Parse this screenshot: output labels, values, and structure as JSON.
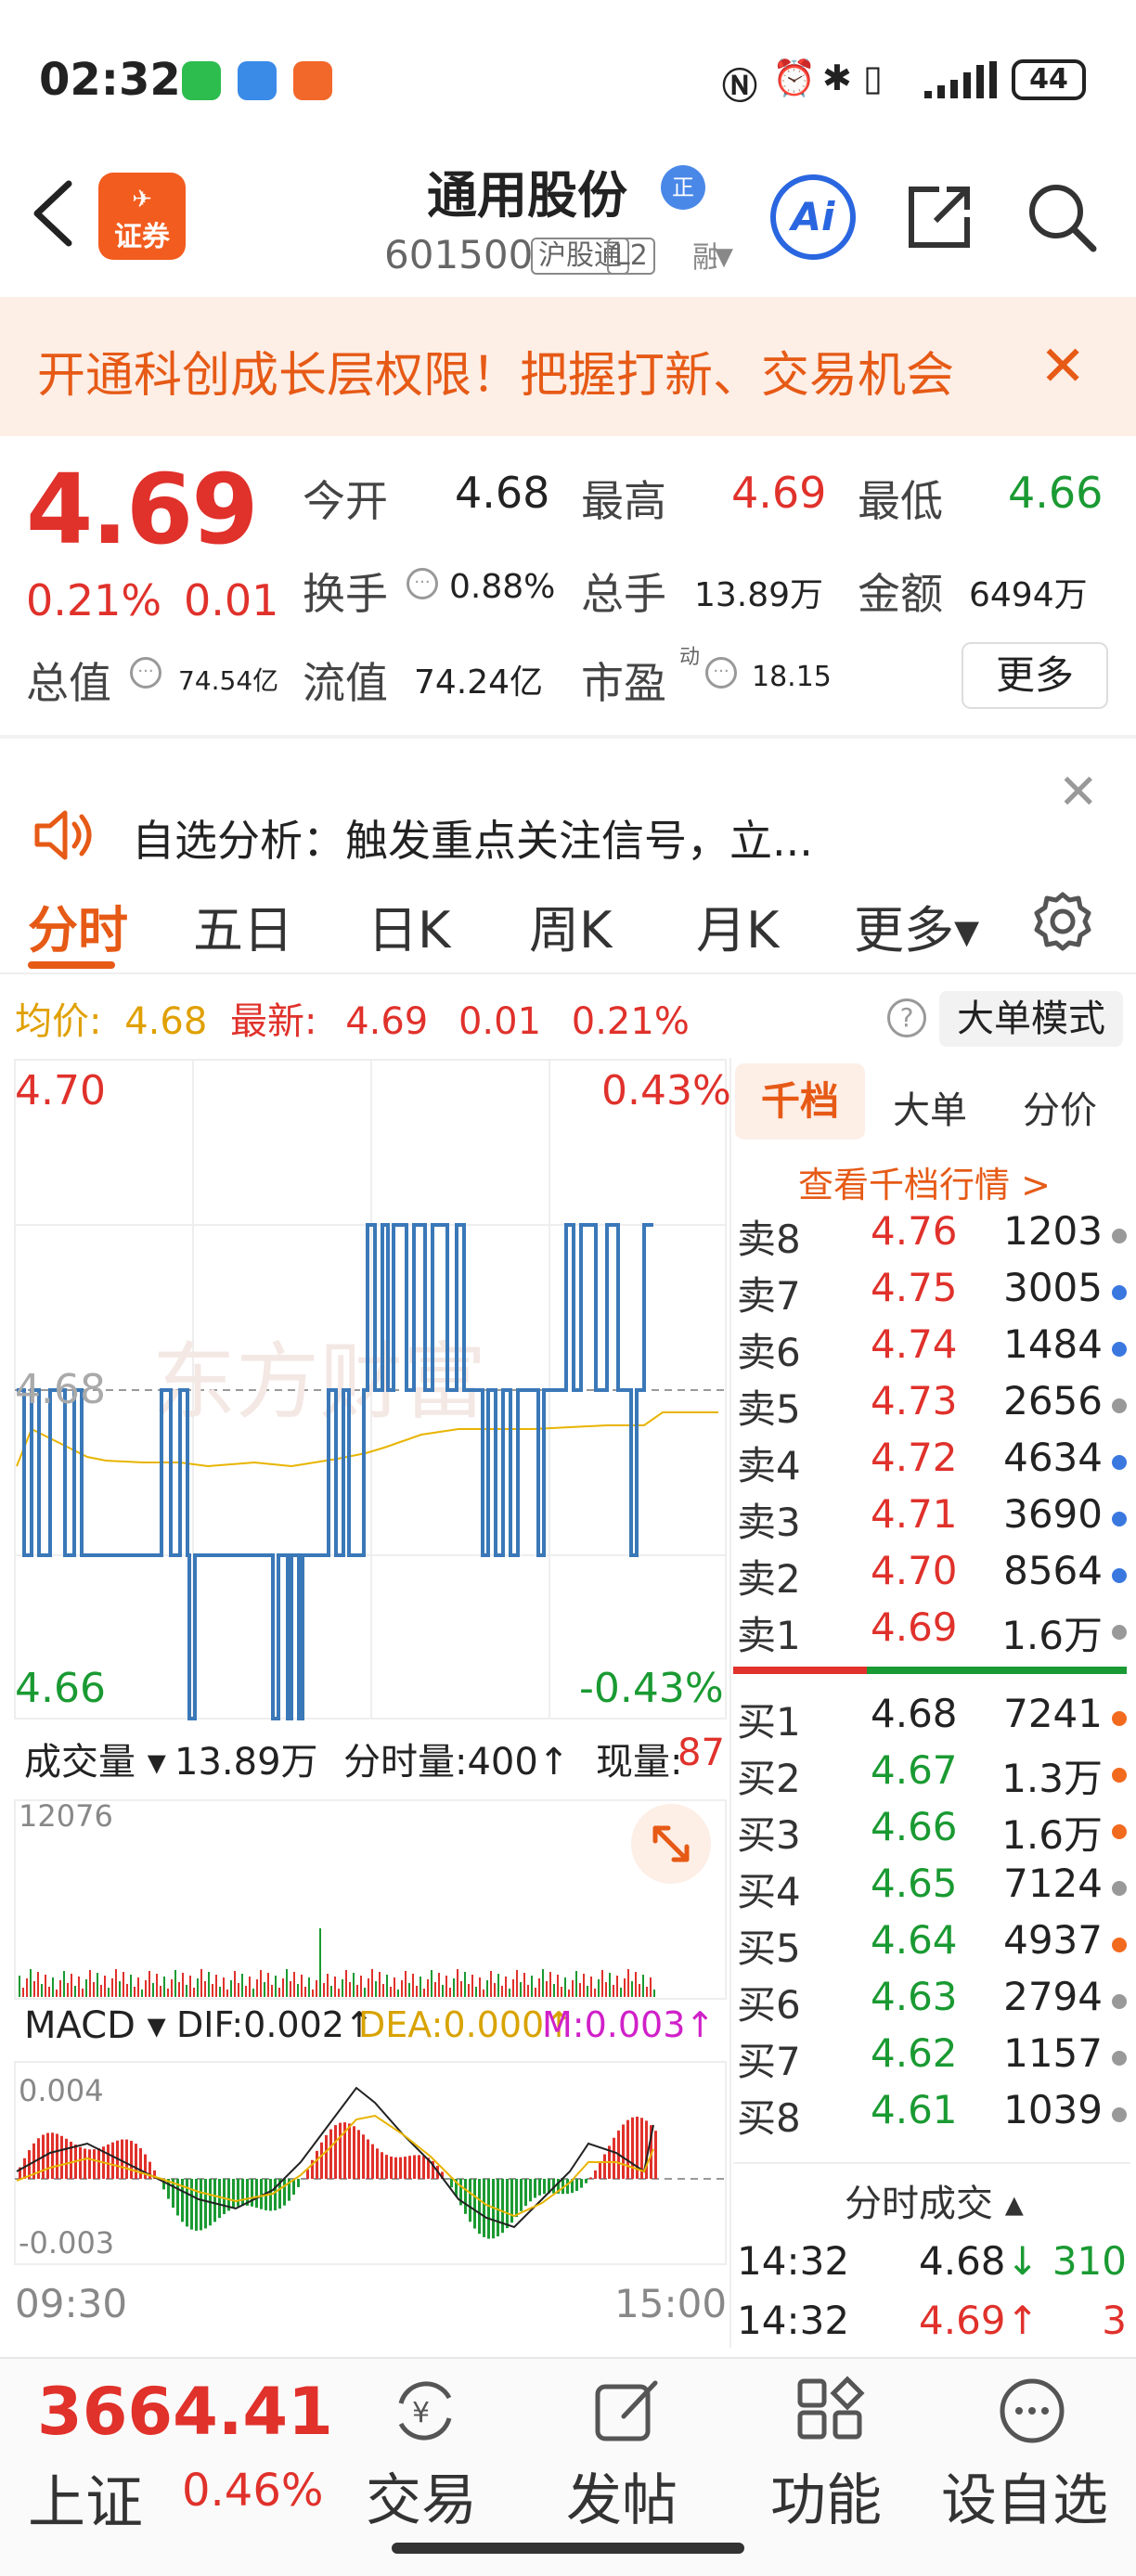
{
  "status_bar": {
    "time": "02:32",
    "battery": "44"
  },
  "header": {
    "back_icon": "chevron-left-icon",
    "logo_text": "证券",
    "stock_name": "通用股份",
    "badge": "正",
    "stock_code": "601500",
    "tag1": "沪股通",
    "tag2": "L2",
    "tag3": "融"
  },
  "banner": {
    "text": "开通科创成长层权限！把握打新、交易机会",
    "close": "✕"
  },
  "quote": {
    "price": "4.69",
    "change_pct": "0.21%",
    "change_val": "0.01",
    "open_label": "今开",
    "open": "4.68",
    "high_label": "最高",
    "high": "4.69",
    "low_label": "最低",
    "low": "4.66",
    "turnover_label": "换手",
    "turnover": "0.88%",
    "volume_label": "总手",
    "volume": "13.89万",
    "amount_label": "金额",
    "amount": "6494万",
    "mktcap_label": "总值",
    "mktcap": "74.54亿",
    "float_label": "流值",
    "float": "74.24亿",
    "pe_label": "市盈",
    "pe_sup": "动",
    "pe": "18.15",
    "more": "更多"
  },
  "notice": {
    "text": "自选分析：触发重点关注信号，立...",
    "close": "✕"
  },
  "tabs": [
    "分时",
    "五日",
    "日K",
    "周K",
    "月K",
    "更多▾"
  ],
  "price_row": {
    "avg_label": "均价:",
    "avg": "4.68",
    "latest_label": "最新:",
    "latest": "4.69",
    "chg": "0.01",
    "pct": "0.21%",
    "help": "?",
    "big_order": "大单模式"
  },
  "chart": {
    "y_top": "4.70",
    "pct_top": "0.43%",
    "y_mid": "4.68",
    "y_bot": "4.66",
    "pct_bot": "-0.43%",
    "vol_label": "成交量 ▾",
    "vol_total": "13.89万",
    "vol_unit": "分时量:400↑",
    "vol_now_label": "现量:",
    "vol_now": "87",
    "vol_max": "12076",
    "macd_label": "MACD ▾",
    "dif": "DIF:0.002↑",
    "dea": "DEA:0.000↑",
    "m": "M:0.003↑",
    "macd_top": "0.004",
    "macd_bot": "-0.003",
    "time_start": "09:30",
    "time_end": "15:00"
  },
  "order_book": {
    "tabs": [
      "千档",
      "大单",
      "分价"
    ],
    "link": "查看千档行情 >",
    "asks": [
      {
        "label": "卖8",
        "price": "4.76",
        "vol": "1203",
        "dot": "#999999"
      },
      {
        "label": "卖7",
        "price": "4.75",
        "vol": "3005",
        "dot": "#3a78e0"
      },
      {
        "label": "卖6",
        "price": "4.74",
        "vol": "1484",
        "dot": "#3a78e0"
      },
      {
        "label": "卖5",
        "price": "4.73",
        "vol": "2656",
        "dot": "#999999"
      },
      {
        "label": "卖4",
        "price": "4.72",
        "vol": "4634",
        "dot": "#3a78e0"
      },
      {
        "label": "卖3",
        "price": "4.71",
        "vol": "3690",
        "dot": "#3a78e0"
      },
      {
        "label": "卖2",
        "price": "4.70",
        "vol": "8564",
        "dot": "#3a78e0"
      },
      {
        "label": "卖1",
        "price": "4.69",
        "vol": "1.6万",
        "dot": "#999999"
      }
    ],
    "bids": [
      {
        "label": "买1",
        "price": "4.68",
        "vol": "7241",
        "dot": "#f26a1e"
      },
      {
        "label": "买2",
        "price": "4.67",
        "vol": "1.3万",
        "dot": "#f26a1e"
      },
      {
        "label": "买3",
        "price": "4.66",
        "vol": "1.6万",
        "dot": "#f26a1e"
      },
      {
        "label": "买4",
        "price": "4.65",
        "vol": "7124",
        "dot": "#999999"
      },
      {
        "label": "买5",
        "price": "4.64",
        "vol": "4937",
        "dot": "#f26a1e"
      },
      {
        "label": "买6",
        "price": "4.63",
        "vol": "2794",
        "dot": "#999999"
      },
      {
        "label": "买7",
        "price": "4.62",
        "vol": "1157",
        "dot": "#999999"
      },
      {
        "label": "买8",
        "price": "4.61",
        "vol": "1039",
        "dot": "#999999"
      }
    ],
    "ticks_title": "分时成交 ▴",
    "ticks": [
      {
        "time": "14:32",
        "price": "4.68",
        "dir": "↓",
        "vol": "310",
        "price_color": "#222222",
        "dir_color": "#1a9a32",
        "vol_color": "#1a9a32"
      },
      {
        "time": "14:32",
        "price": "4.69",
        "dir": "↑",
        "vol": "3",
        "price_color": "#e0312b",
        "dir_color": "#e0312b",
        "vol_color": "#e0312b"
      }
    ]
  },
  "bottom_bar": {
    "index_value": "3664.41",
    "index_name": "上证",
    "index_pct": "0.46%",
    "nav": [
      "交易",
      "发帖",
      "功能",
      "设自选"
    ]
  }
}
